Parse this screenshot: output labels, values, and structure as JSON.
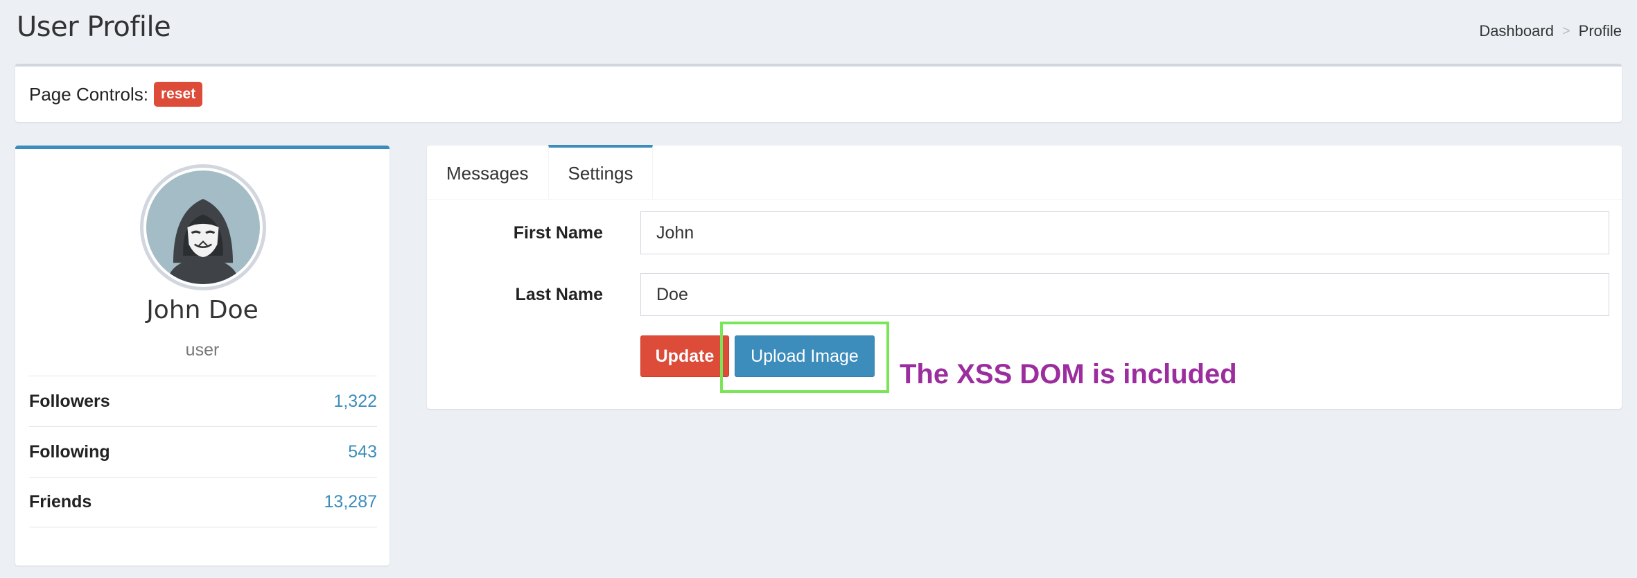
{
  "header": {
    "title": "User Profile",
    "breadcrumb": [
      "Dashboard",
      "Profile"
    ],
    "breadcrumb_separator": ">"
  },
  "page_controls": {
    "label": "Page Controls:",
    "reset_label": "reset"
  },
  "profile": {
    "avatar_icon": "anonymous-hooded-mask-icon",
    "name": "John Doe",
    "role": "user",
    "stats": [
      {
        "label": "Followers",
        "value": "1,322"
      },
      {
        "label": "Following",
        "value": "543"
      },
      {
        "label": "Friends",
        "value": "13,287"
      }
    ]
  },
  "tabs": [
    {
      "label": "Messages",
      "active": false
    },
    {
      "label": "Settings",
      "active": true
    }
  ],
  "settings_form": {
    "first_name_label": "First Name",
    "first_name_value": "John",
    "last_name_label": "Last Name",
    "last_name_value": "Doe",
    "update_label": "Update",
    "upload_label": "Upload Image"
  },
  "annotation": {
    "text": "The XSS DOM is included",
    "color": "#9b2d9f",
    "highlight_color": "#7be55a"
  },
  "colors": {
    "primary": "#3c8dbc",
    "danger": "#dd4b39",
    "background": "#ecf0f5"
  }
}
